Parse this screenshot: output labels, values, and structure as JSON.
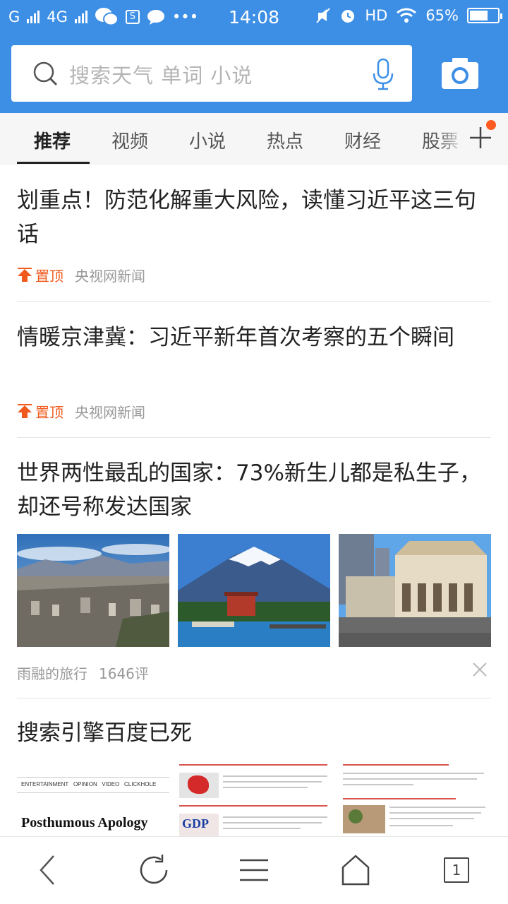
{
  "status_bar": {
    "carrier1": "G",
    "carrier2": "4G",
    "time": "14:08",
    "hd": "HD",
    "battery": "65%",
    "battery_level": 0.65
  },
  "search": {
    "placeholder": "搜索天气 单词 小说"
  },
  "tabs": [
    {
      "label": "推荐",
      "active": true
    },
    {
      "label": "视频"
    },
    {
      "label": "小说"
    },
    {
      "label": "热点"
    },
    {
      "label": "财经"
    },
    {
      "label": "股票"
    }
  ],
  "feed": [
    {
      "title": "划重点！防范化解重大风险，读懂习近平这三句话",
      "pinned_label": "置顶",
      "source": "央视网新闻"
    },
    {
      "title": "情暖京津冀：习近平新年首次考察的五个瞬间",
      "pinned_label": "置顶",
      "source": "央视网新闻"
    },
    {
      "title": "世界两性最乱的国家：73%新生儿都是私生子，却还号称发达国家",
      "source": "雨融的旅行",
      "comments": "1646评"
    },
    {
      "title": "搜索引擎百度已死",
      "thumb_texts": {
        "nav_items": [
          "ENTERTAINMENT",
          "OPINION",
          "VIDEO",
          "CLICKHOLE"
        ],
        "headline": "Posthumous Apology",
        "gdp_logo": "GDP"
      }
    }
  ],
  "bottom_nav": {
    "tab_count": "1"
  },
  "colors": {
    "header_blue": "#3d8fe6",
    "accent_orange": "#f05a1e",
    "badge_dot": "#ff5a1f"
  }
}
